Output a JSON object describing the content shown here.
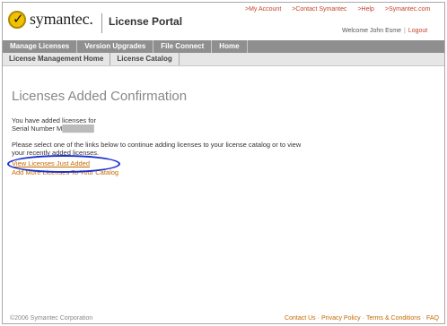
{
  "header": {
    "logo_text": "symantec.",
    "portal_title": "License Portal",
    "top_links": [
      ">My Account",
      ">Contact Symantec",
      ">Help",
      ">Symantec.com"
    ],
    "welcome": "Welcome John Esme",
    "logout": "Logout"
  },
  "nav": {
    "primary": [
      "Manage Licenses",
      "Version Upgrades",
      "File Connect",
      "Home"
    ],
    "secondary": [
      "License Management Home",
      "License Catalog"
    ]
  },
  "main": {
    "title": "Licenses Added Confirmation",
    "line1": "You have added licenses for",
    "serial_label": "Serial Number M",
    "serial_value": "████████",
    "instruction1": "Please select one of the links below to continue adding licenses to your license catalog or to view",
    "instruction2": "your recently added licenses.",
    "link_view": "View Licenses Just Added",
    "link_add": "Add More Licenses To Your Catalog"
  },
  "footer": {
    "copyright": "©2006 Symantec Corporation",
    "links": [
      "Contact Us",
      "Privacy Policy",
      "Terms & Conditions",
      "FAQ"
    ]
  },
  "colors": {
    "nav_primary_bg": "#8f8f8f",
    "link": "#c46a00",
    "highlight": "#1a2fd0"
  }
}
